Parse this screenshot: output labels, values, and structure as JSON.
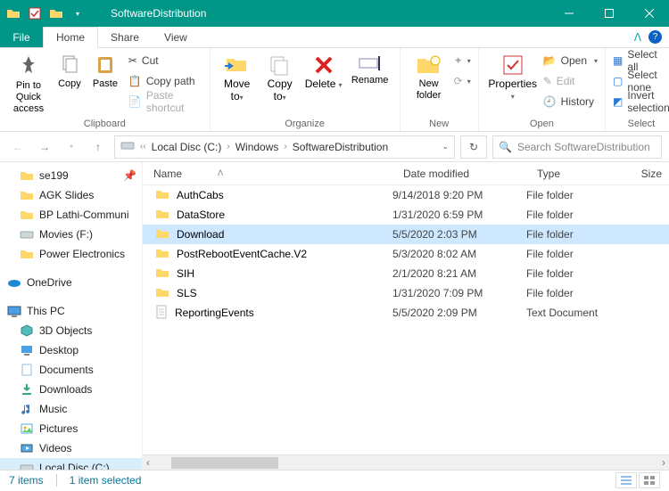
{
  "title": "SoftwareDistribution",
  "tabs": {
    "file": "File",
    "home": "Home",
    "share": "Share",
    "view": "View"
  },
  "ribbon": {
    "pin": "Pin to Quick\naccess",
    "copy": "Copy",
    "paste": "Paste",
    "cut": "Cut",
    "copypath": "Copy path",
    "pasteshort": "Paste shortcut",
    "clipboard_group": "Clipboard",
    "moveto": "Move\nto",
    "copyto": "Copy\nto",
    "delete": "Delete",
    "rename": "Rename",
    "organize_group": "Organize",
    "newfolder": "New\nfolder",
    "newitem": "",
    "new_group": "New",
    "properties": "Properties",
    "open": "Open",
    "edit": "Edit",
    "history": "History",
    "open_group": "Open",
    "selectall": "Select all",
    "selectnone": "Select none",
    "invert": "Invert selection",
    "select_group": "Select"
  },
  "breadcrumb": {
    "b1": "Local Disc (C:)",
    "b2": "Windows",
    "b3": "SoftwareDistribution"
  },
  "search_placeholder": "Search SoftwareDistribution",
  "columns": {
    "name": "Name",
    "date": "Date modified",
    "type": "Type",
    "size": "Size"
  },
  "files": [
    {
      "name": "AuthCabs",
      "date": "9/14/2018 9:20 PM",
      "type": "File folder",
      "icon": "folder"
    },
    {
      "name": "DataStore",
      "date": "1/31/2020 6:59 PM",
      "type": "File folder",
      "icon": "folder"
    },
    {
      "name": "Download",
      "date": "5/5/2020 2:03 PM",
      "type": "File folder",
      "icon": "folder",
      "selected": true
    },
    {
      "name": "PostRebootEventCache.V2",
      "date": "5/3/2020 8:02 AM",
      "type": "File folder",
      "icon": "folder"
    },
    {
      "name": "SIH",
      "date": "2/1/2020 8:21 AM",
      "type": "File folder",
      "icon": "folder"
    },
    {
      "name": "SLS",
      "date": "1/31/2020 7:09 PM",
      "type": "File folder",
      "icon": "folder"
    },
    {
      "name": "ReportingEvents",
      "date": "5/5/2020 2:09 PM",
      "type": "Text Document",
      "icon": "file"
    }
  ],
  "tree": {
    "quick": [
      {
        "label": "se199",
        "icon": "folder",
        "pinned": true
      },
      {
        "label": "AGK Slides",
        "icon": "folder"
      },
      {
        "label": "BP Lathi-Communi",
        "icon": "folder"
      },
      {
        "label": "Movies (F:)",
        "icon": "drive"
      },
      {
        "label": "Power Electronics",
        "icon": "folder"
      }
    ],
    "onedrive": "OneDrive",
    "thispc": "This PC",
    "pcitems": [
      {
        "label": "3D Objects",
        "icon": "3d"
      },
      {
        "label": "Desktop",
        "icon": "desktop"
      },
      {
        "label": "Documents",
        "icon": "docs"
      },
      {
        "label": "Downloads",
        "icon": "downloads"
      },
      {
        "label": "Music",
        "icon": "music"
      },
      {
        "label": "Pictures",
        "icon": "pictures"
      },
      {
        "label": "Videos",
        "icon": "videos"
      },
      {
        "label": "Local Disc (C:)",
        "icon": "drive",
        "selected": true
      }
    ]
  },
  "status": {
    "count": "7 items",
    "selected": "1 item selected"
  },
  "colors": {
    "accent": "#009688",
    "selection": "#cde8ff"
  }
}
